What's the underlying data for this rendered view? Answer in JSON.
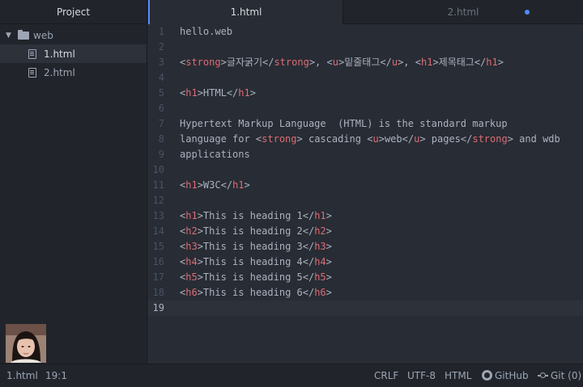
{
  "sidebar": {
    "title": "Project",
    "folder": "web",
    "files": [
      "1.html",
      "2.html"
    ],
    "selected_file": "1.html"
  },
  "tabs": [
    {
      "label": "1.html",
      "active": true,
      "modified": false
    },
    {
      "label": "2.html",
      "active": false,
      "modified": true
    }
  ],
  "editor": {
    "current_line": 19,
    "lines": [
      {
        "n": "1",
        "text": "hello.web"
      },
      {
        "n": "2",
        "text": ""
      },
      {
        "n": "3",
        "text": "<strong>글자굵기</strong>, <u>밑줄태그</u>, <h1>제목태그</h1>"
      },
      {
        "n": "4",
        "text": ""
      },
      {
        "n": "5",
        "text": "<h1>HTML</h1>"
      },
      {
        "n": "6",
        "text": ""
      },
      {
        "n": "7",
        "text": "Hypertext Markup Language  (HTML) is the standard markup"
      },
      {
        "n": "8",
        "text": "language for <strong> cascading <u>web</u> pages</strong> and wdb"
      },
      {
        "n": "9",
        "text": "applications"
      },
      {
        "n": "10",
        "text": ""
      },
      {
        "n": "11",
        "text": "<h1>W3C</h1>"
      },
      {
        "n": "12",
        "text": ""
      },
      {
        "n": "13",
        "text": "<h1>This is heading 1</h1>"
      },
      {
        "n": "14",
        "text": "<h2>This is heading 2</h2>"
      },
      {
        "n": "15",
        "text": "<h3>This is heading 3</h3>"
      },
      {
        "n": "16",
        "text": "<h4>This is heading 4</h4>"
      },
      {
        "n": "17",
        "text": "<h5>This is heading 5</h5>"
      },
      {
        "n": "18",
        "text": "<h6>This is heading 6</h6>"
      },
      {
        "n": "19",
        "text": ""
      }
    ]
  },
  "statusbar": {
    "file": "1.html",
    "cursor_pos": "19:1",
    "line_ending": "CRLF",
    "encoding": "UTF-8",
    "grammar": "HTML",
    "github": "GitHub",
    "git": "Git (0)"
  },
  "colors": {
    "background": "#282c34",
    "panel": "#21252b",
    "tag": "#e06c75",
    "text": "#abb2bf",
    "accent": "#528bff"
  }
}
